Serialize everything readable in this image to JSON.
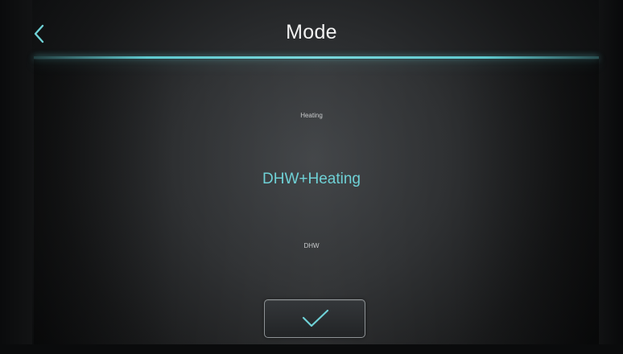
{
  "header": {
    "title": "Mode",
    "back_icon": "chevron-left-icon"
  },
  "mode_picker": {
    "options": [
      {
        "label": "Heating",
        "selected": false
      },
      {
        "label": "DHW+Heating",
        "selected": true
      },
      {
        "label": "DHW",
        "selected": false
      }
    ]
  },
  "confirm": {
    "icon": "checkmark-icon"
  },
  "colors": {
    "accent": "#6fd1d6",
    "title_text": "#f2f2f2",
    "option_text": "#c9cbcc",
    "background": "#2a2c2e"
  }
}
